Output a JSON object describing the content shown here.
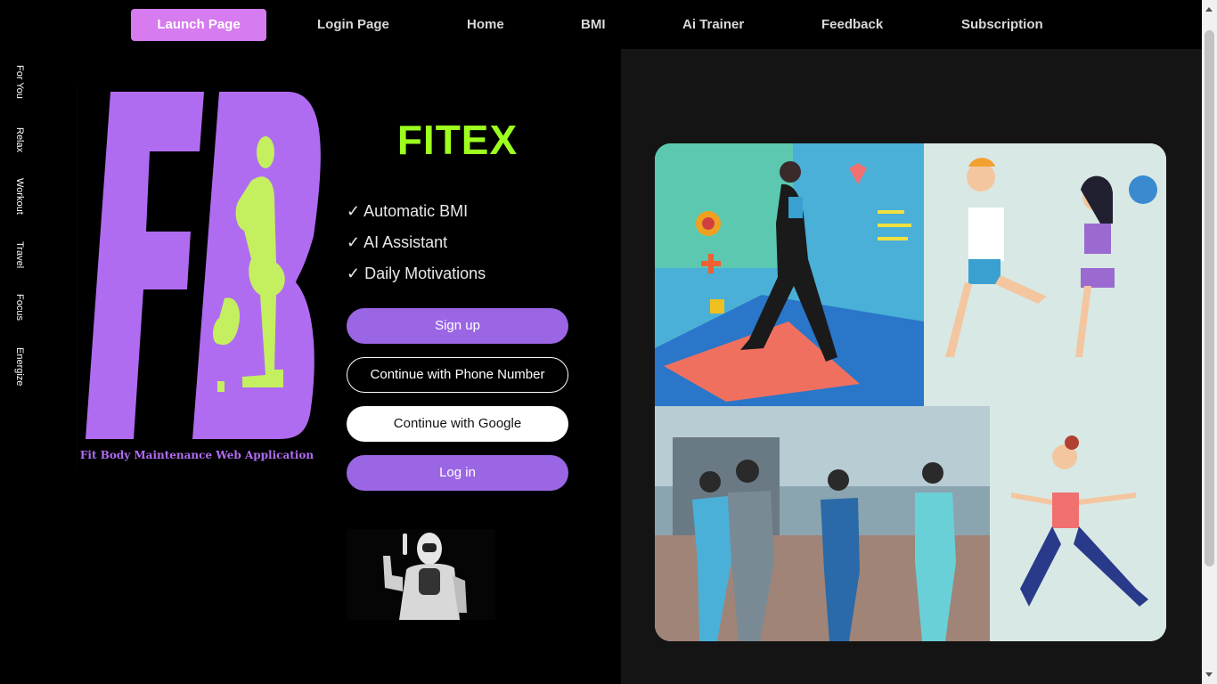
{
  "nav": {
    "items": [
      {
        "label": "Launch Page",
        "active": true
      },
      {
        "label": "Login Page"
      },
      {
        "label": "Home"
      },
      {
        "label": "BMI"
      },
      {
        "label": "Ai Trainer"
      },
      {
        "label": "Feedback"
      },
      {
        "label": "Subscription"
      }
    ],
    "active_color": "#d67bf0"
  },
  "sidebar": {
    "items": [
      "For You",
      "Relax",
      "Workout",
      "Travel",
      "Focus",
      "Energize"
    ]
  },
  "logo": {
    "letters": "FB",
    "tagline": "Fit Body Maintenance Web Application",
    "primary_color": "#b06cf0",
    "figure_color": "#c4f060"
  },
  "hero": {
    "brand": "FITEX",
    "brand_color": "#9dff1e",
    "features": [
      "✓ Automatic BMI",
      "✓ AI Assistant",
      "✓ Daily Motivations"
    ]
  },
  "actions": {
    "signup": "Sign up",
    "phone": "Continue with Phone Number",
    "google": "Continue with Google",
    "login": "Log in",
    "button_color": "#9a66e4"
  },
  "images": {
    "robot": "robot-illustration",
    "collage": "fitness-collage"
  }
}
